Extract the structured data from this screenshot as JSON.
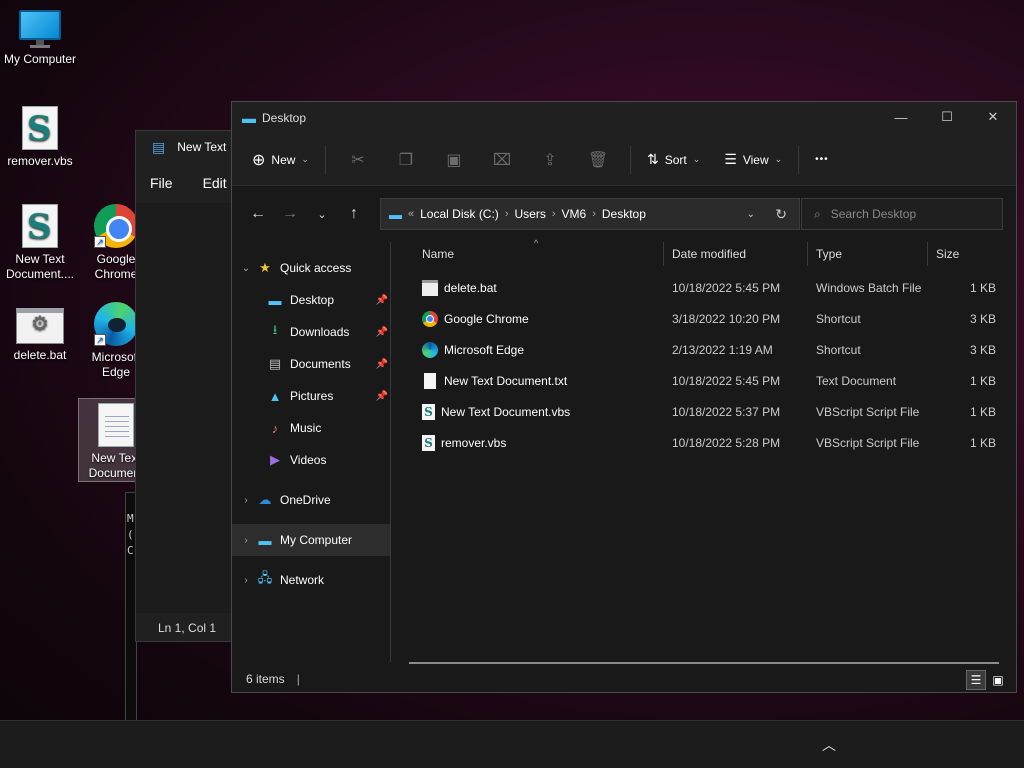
{
  "desktop": {
    "icons": [
      {
        "label": "My Computer",
        "icon": "monitor-icon"
      },
      {
        "label": "remover.vbs",
        "icon": "vbs-script-icon"
      },
      {
        "label": "New Text Document....",
        "icon": "vbs-script-icon"
      },
      {
        "label": "delete.bat",
        "icon": "batch-file-icon"
      },
      {
        "label": "Google Chrome",
        "icon": "chrome-icon"
      },
      {
        "label": "Microsoft Edge",
        "icon": "edge-icon"
      },
      {
        "label": "New Text Document",
        "icon": "text-document-icon"
      }
    ]
  },
  "notepad": {
    "title": "New Text",
    "menu": {
      "file": "File",
      "edit": "Edit"
    },
    "status": "Ln 1, Col 1"
  },
  "cmd_peek": {
    "lines": [
      "M",
      "(",
      "C"
    ]
  },
  "explorer": {
    "title": "Desktop",
    "toolbar": {
      "new_label": "New",
      "sort_label": "Sort",
      "view_label": "View",
      "more_label": "•••"
    },
    "address": {
      "crumbs": [
        "Local Disk (C:)",
        "Users",
        "VM6",
        "Desktop"
      ],
      "search_placeholder": "Search Desktop"
    },
    "nav": {
      "quick_access": "Quick access",
      "desktop": "Desktop",
      "downloads": "Downloads",
      "documents": "Documents",
      "pictures": "Pictures",
      "music": "Music",
      "videos": "Videos",
      "onedrive": "OneDrive",
      "my_computer": "My Computer",
      "network": "Network"
    },
    "columns": {
      "name": "Name",
      "date": "Date modified",
      "type": "Type",
      "size": "Size"
    },
    "files": [
      {
        "name": "delete.bat",
        "date": "10/18/2022 5:45 PM",
        "type": "Windows Batch File",
        "size": "1 KB",
        "icon": "batch-file-icon"
      },
      {
        "name": "Google Chrome",
        "date": "3/18/2022 10:20 PM",
        "type": "Shortcut",
        "size": "3 KB",
        "icon": "chrome-icon"
      },
      {
        "name": "Microsoft Edge",
        "date": "2/13/2022 1:19 AM",
        "type": "Shortcut",
        "size": "3 KB",
        "icon": "edge-icon"
      },
      {
        "name": "New Text Document.txt",
        "date": "10/18/2022 5:45 PM",
        "type": "Text Document",
        "size": "1 KB",
        "icon": "text-document-icon"
      },
      {
        "name": "New Text Document.vbs",
        "date": "10/18/2022 5:37 PM",
        "type": "VBScript Script File",
        "size": "1 KB",
        "icon": "vbs-script-icon"
      },
      {
        "name": "remover.vbs",
        "date": "10/18/2022 5:28 PM",
        "type": "VBScript Script File",
        "size": "1 KB",
        "icon": "vbs-script-icon"
      }
    ],
    "status": "6 items"
  }
}
